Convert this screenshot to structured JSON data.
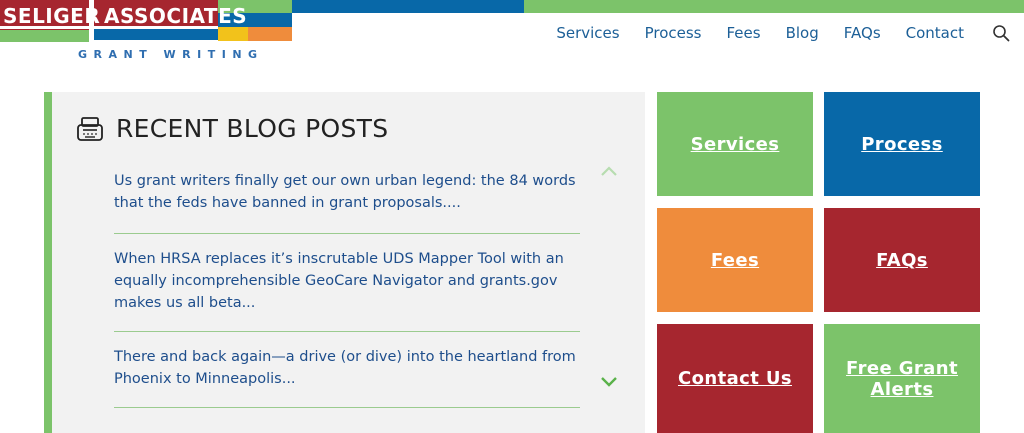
{
  "colors": {
    "brand_red": "#a6262f",
    "brand_blue": "#0868a8",
    "brand_green": "#7cc36a",
    "brand_orange": "#ef8c3c",
    "brand_yellow": "#f2c21b",
    "link_blue": "#1e4e8c"
  },
  "logo": {
    "word1": "SELIGER",
    "word2": "ASSOCIATES",
    "tagline": "GRANT WRITING"
  },
  "nav": {
    "items": [
      {
        "label": "Services"
      },
      {
        "label": "Process"
      },
      {
        "label": "Fees"
      },
      {
        "label": "Blog"
      },
      {
        "label": "FAQs"
      },
      {
        "label": "Contact"
      }
    ],
    "search_icon": "search-icon"
  },
  "blog": {
    "title": "RECENT BLOG POSTS",
    "icon": "typewriter-icon",
    "posts": [
      {
        "text": "Us grant writers finally get our own urban legend: the 84 words that the feds have banned in grant proposals...."
      },
      {
        "text": "When HRSA replaces it’s inscrutable UDS Mapper Tool with an equally incomprehensible GeoCare Navigator and grants.gov makes us all beta..."
      },
      {
        "text": "There and back again—a drive (or dive) into the heartland from Phoenix to Minneapolis..."
      }
    ],
    "scroll_up_icon": "chevron-up-icon",
    "scroll_down_icon": "chevron-down-icon"
  },
  "tiles": {
    "services": "Services",
    "process": "Process",
    "fees": "Fees",
    "faqs": "FAQs",
    "contact": "Contact Us",
    "alerts": "Free Grant Alerts"
  }
}
